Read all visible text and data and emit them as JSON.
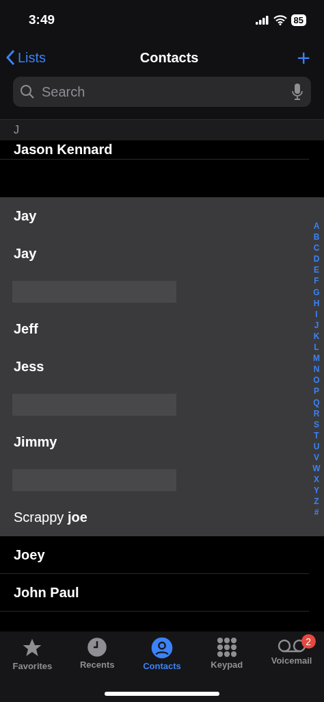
{
  "status_bar": {
    "time": "3:49",
    "battery": "85"
  },
  "nav": {
    "back": "Lists",
    "title": "Contacts",
    "add": "+"
  },
  "search": {
    "placeholder": "Search"
  },
  "section": {
    "letter": "J"
  },
  "contacts": [
    {
      "kind": "name",
      "name": "Jason Kennard",
      "selected": false
    },
    {
      "kind": "gap",
      "selected": false
    },
    {
      "kind": "name",
      "name": "Jay",
      "selected": true
    },
    {
      "kind": "name",
      "name": "Jay",
      "selected": true
    },
    {
      "kind": "redacted",
      "selected": true
    },
    {
      "kind": "name",
      "name": "Jeff",
      "selected": true
    },
    {
      "kind": "name",
      "name": "Jess",
      "selected": true
    },
    {
      "kind": "redacted",
      "selected": true
    },
    {
      "kind": "name",
      "name": "Jimmy",
      "selected": true
    },
    {
      "kind": "redacted",
      "selected": true
    },
    {
      "kind": "name",
      "name": "Scrappy **joe**",
      "selected": true
    },
    {
      "kind": "name",
      "name": "Joey",
      "selected": false
    },
    {
      "kind": "name",
      "name": "John Paul",
      "selected": false
    }
  ],
  "index": [
    "A",
    "B",
    "C",
    "D",
    "E",
    "F",
    "G",
    "H",
    "I",
    "J",
    "K",
    "L",
    "M",
    "N",
    "O",
    "P",
    "Q",
    "R",
    "S",
    "T",
    "U",
    "V",
    "W",
    "X",
    "Y",
    "Z",
    "#"
  ],
  "tabs": [
    {
      "label": "Favorites",
      "selected": false
    },
    {
      "label": "Recents",
      "selected": false
    },
    {
      "label": "Contacts",
      "selected": true
    },
    {
      "label": "Keypad",
      "selected": false
    },
    {
      "label": "Voicemail",
      "selected": false,
      "badge": "2"
    }
  ]
}
